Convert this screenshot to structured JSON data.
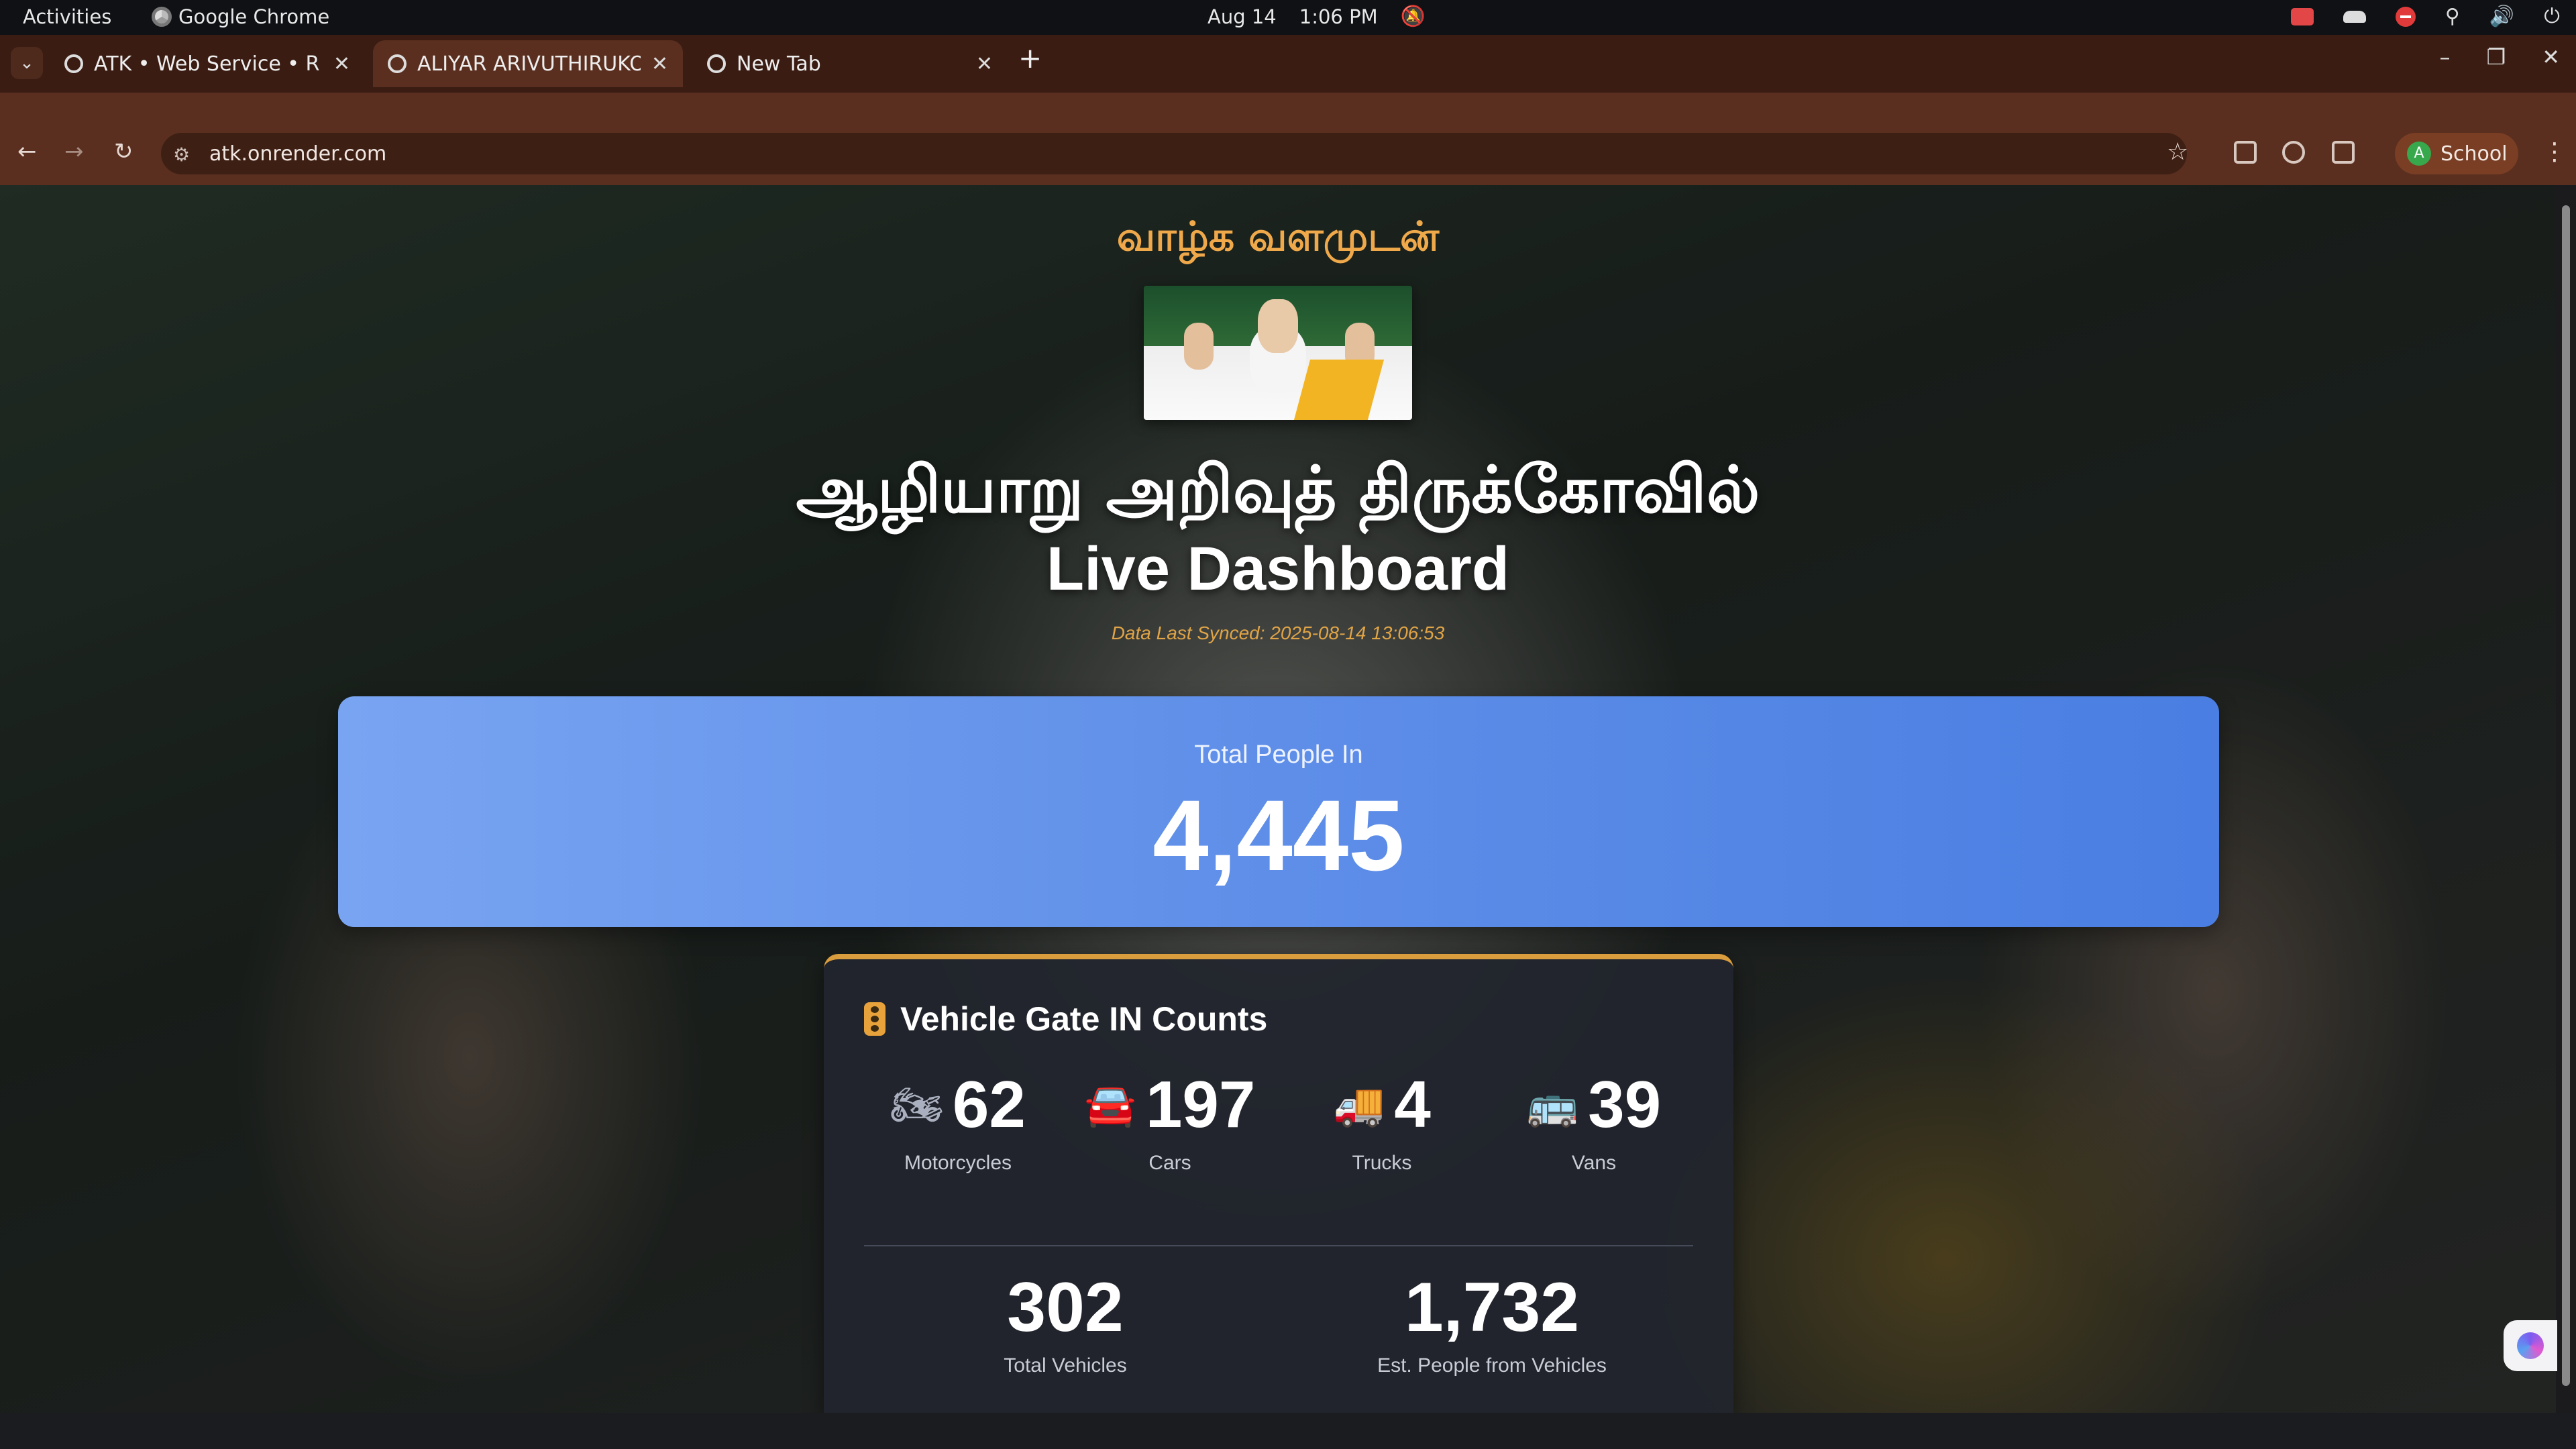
{
  "system_bar": {
    "activities": "Activities",
    "app_name": "Google Chrome",
    "date": "Aug 14",
    "time": "1:06 PM"
  },
  "browser": {
    "tabs": [
      {
        "title": "ATK • Web Service • R",
        "active": false
      },
      {
        "title": "ALIYAR ARIVUTHIRUKOI",
        "active": true
      },
      {
        "title": "New Tab",
        "active": false
      }
    ],
    "url": "atk.onrender.com",
    "profile_initial": "A",
    "profile_name": "School",
    "colors": {
      "frame": "#3a1c12",
      "toolbar": "#5a2f1f",
      "profile": "#7a3e24"
    }
  },
  "page": {
    "greeting": "வாழ்க வளமுடன்",
    "temple_name": "ஆழியாறு அறிவுத் திருக்கோவில்",
    "dashboard_title": "Live Dashboard",
    "synced_text": "Data Last Synced: 2025-08-14 13:06:53",
    "people": {
      "label": "Total People In",
      "value": "4,445"
    },
    "vehicles": {
      "title": "Vehicle Gate IN Counts",
      "items": [
        {
          "icon": "motorcycle-icon",
          "value": "62",
          "label": "Motorcycles"
        },
        {
          "icon": "car-icon",
          "value": "197",
          "label": "Cars"
        },
        {
          "icon": "truck-icon",
          "value": "4",
          "label": "Trucks"
        },
        {
          "icon": "van-icon",
          "value": "39",
          "label": "Vans"
        }
      ],
      "total_vehicles": {
        "value": "302",
        "label": "Total Vehicles"
      },
      "est_people": {
        "value": "1,732",
        "label": "Est. People from Vehicles"
      }
    },
    "colors": {
      "accent_gold": "#f0a94a",
      "people_card_blue": "#5e8ee8",
      "card_border": "#d99d3e"
    }
  }
}
